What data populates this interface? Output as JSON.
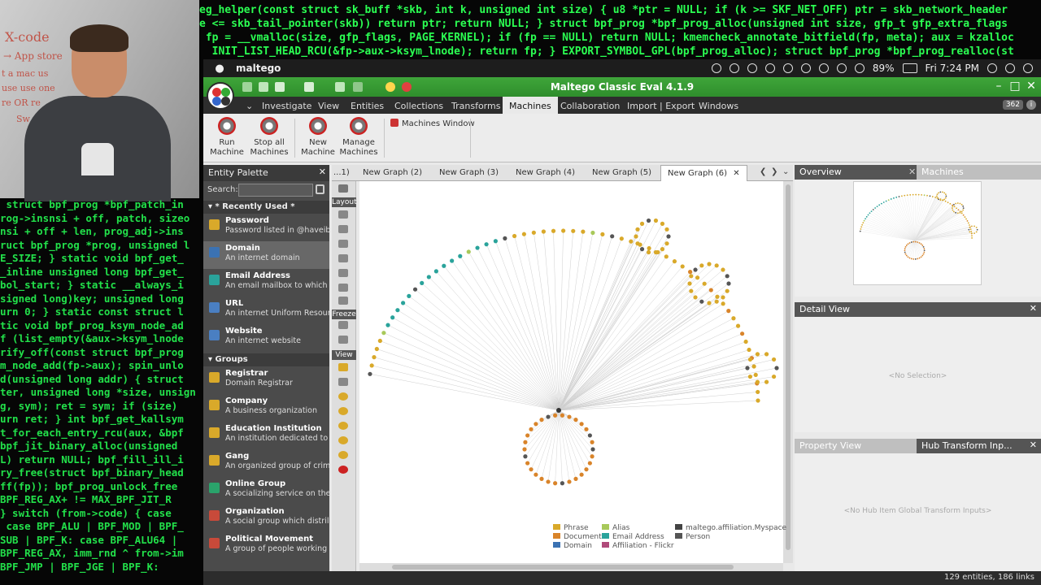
{
  "background": {
    "code_top": [
      "eg_helper(const struct sk_buff *skb, int k, unsigned int size) { u8 *ptr = NULL; if (k >= SKF_NET_OFF) ptr = skb_network_header",
      "e <= skb_tail_pointer(skb)) return ptr; return NULL; } struct bpf_prog *bpf_prog_alloc(unsigned int size, gfp_t gfp_extra_flags",
      " fp = __vmalloc(size, gfp_flags, PAGE_KERNEL); if (fp == NULL) return NULL; kmemcheck_annotate_bitfield(fp, meta); aux = kzalloc",
      "  INIT_LIST_HEAD_RCU(&fp->aux->ksym_lnode); return fp; } EXPORT_SYMBOL_GPL(bpf_prog_alloc); struct bpf_prog *bpf_prog_realloc(st"
    ],
    "code_left": [
      " struct bpf_prog *bpf_patch_in",
      "rog->insnsi + off, patch, sizeo",
      "nsi + off + len, prog_adj->ins",
      "ruct bpf_prog *prog, unsigned l",
      "E_SIZE; } static void bpf_get_",
      "_inline unsigned long bpf_get_",
      "bol_start; } static __always_i",
      "signed long)key; unsigned long",
      "urn 0; } static const struct l",
      "tic void bpf_prog_ksym_node_ad",
      "f (list_empty(&aux->ksym_lnode",
      "rify_off(const struct bpf_prog",
      "m_node_add(fp->aux); spin_unlo",
      "d(unsigned long addr) { struct",
      "ter, unsigned long *size, unsign",
      "g, sym); ret = sym; if (size)",
      "urn ret; } int bpf_get_kallsym",
      "t_for_each_entry_rcu(aux, &bpf",
      "bpf_jit_binary_alloc(unsigned",
      "L) return NULL; bpf_fill_ill_i",
      "ry_free(struct bpf_binary_head",
      "ff(fp)); bpf_prog_unlock_free",
      "BPF_REG_AX+ != MAX_BPF_JIT_R",
      "} switch (from->code) { case",
      " case BPF_ALU | BPF_MOD | BPF_",
      "SUB | BPF_K: case BPF_ALU64 |",
      "BPF_REG_AX, imm_rnd ^ from->im",
      "BPF_JMP | BPF_JGE | BPF_K:"
    ],
    "whiteboard_notes": [
      "X-code",
      "→ App store",
      "t a mac us",
      "use use one",
      "re OR re",
      "Sw"
    ]
  },
  "menubar": {
    "apple": "",
    "app_name": "maltego",
    "battery": "89%",
    "clock": "Fri 7:24 PM"
  },
  "window": {
    "title": "Maltego Classic Eval 4.1.9",
    "ribbon_tabs": [
      "Investigate",
      "View",
      "Entities",
      "Collections",
      "Transforms",
      "Machines",
      "Collaboration",
      "Import | Export",
      "Windows"
    ],
    "active_tab": "Machines",
    "badge": "362",
    "ribbon_buttons": [
      {
        "line1": "Run",
        "line2": "Machine"
      },
      {
        "line1": "Stop all",
        "line2": "Machines"
      },
      {
        "line1": "New",
        "line2": "Machine"
      },
      {
        "line1": "Manage",
        "line2": "Machines"
      }
    ],
    "machines_window": "Machines Window"
  },
  "palette": {
    "title": "Entity Palette",
    "search_label": "Search:",
    "search_value": "",
    "section_recent": "* Recently Used *",
    "section_groups": "Groups",
    "recent": [
      {
        "name": "Password",
        "desc": "Password listed in @haveibe",
        "color": "#d9a92a"
      },
      {
        "name": "Domain",
        "desc": "An internet domain",
        "color": "#3b72b3"
      },
      {
        "name": "Email Address",
        "desc": "An email mailbox to which e",
        "color": "#2aa39b"
      },
      {
        "name": "URL",
        "desc": "An internet Uniform Resour",
        "color": "#4a7fc2"
      },
      {
        "name": "Website",
        "desc": "An internet website",
        "color": "#4a7fc2"
      }
    ],
    "groups": [
      {
        "name": "Registrar",
        "desc": "Domain Registrar",
        "color": "#d9a92a"
      },
      {
        "name": "Company",
        "desc": "A business organization",
        "color": "#d9a92a"
      },
      {
        "name": "Education Institution",
        "desc": "An institution dedicated to",
        "color": "#d9a92a"
      },
      {
        "name": "Gang",
        "desc": "An organized group of crim",
        "color": "#d9a92a"
      },
      {
        "name": "Online Group",
        "desc": "A socializing service on the",
        "color": "#2aa36b"
      },
      {
        "name": "Organization",
        "desc": "A social group which distril",
        "color": "#c84a3a"
      },
      {
        "name": "Political Movement",
        "desc": "A group of people working",
        "color": "#c84a3a"
      }
    ]
  },
  "toolstrip": {
    "layout": "Layout",
    "freeze": "Freeze",
    "view": "View"
  },
  "graph_tabs": {
    "tabs": [
      "...1)",
      "New Graph (2)",
      "New Graph (3)",
      "New Graph (4)",
      "New Graph (5)",
      "New Graph (6)"
    ],
    "active": "New Graph (6)"
  },
  "legend": [
    {
      "label": "Phrase",
      "color": "#d9a92a"
    },
    {
      "label": "Alias",
      "color": "#a8c95a"
    },
    {
      "label": "maltego.affiliation.Myspace",
      "color": "#444444"
    },
    {
      "label": "Document",
      "color": "#d9842a"
    },
    {
      "label": "Email Address",
      "color": "#2aa39b"
    },
    {
      "label": "Person",
      "color": "#555555"
    },
    {
      "label": "Domain",
      "color": "#3b72b3"
    },
    {
      "label": "Affiliation - Flickr",
      "color": "#b04a7a"
    }
  ],
  "panels": {
    "overview": "Overview",
    "machines": "Machines",
    "detail_view": "Detail View",
    "no_selection": "<No Selection>",
    "property_view": "Property View",
    "hub_transform": "Hub Transform Inp...",
    "no_hub": "<No Hub Item Global Transform Inputs>"
  },
  "status": "129 entities, 186 links"
}
